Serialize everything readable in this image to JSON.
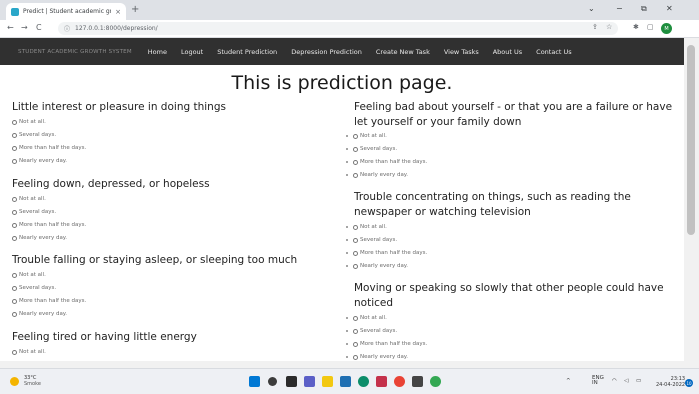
{
  "browser": {
    "tab_title": "Predict | Student academic grow",
    "tab_close": "×",
    "new_tab": "+",
    "url": "127.0.0.1:8000/depression/",
    "back": "←",
    "forward": "→",
    "reload": "C",
    "lock": "ⓘ",
    "minimize": "−",
    "restore": "⧉",
    "close": "✕",
    "chevron": "⌄",
    "share": "⇪",
    "star": "☆",
    "extensions": "✱",
    "sidepanel": "▢",
    "profile": "M"
  },
  "navbar": {
    "brand": "STUDENT ACADEMIC GROWTH SYSTEM",
    "links": [
      "Home",
      "Logout",
      "Student Prediction",
      "Depression Prediction",
      "Create New Task",
      "View Tasks",
      "About Us",
      "Contact Us"
    ]
  },
  "page": {
    "title": "This is prediction page."
  },
  "questions_left": [
    {
      "title": "Little interest or pleasure in doing things",
      "options": [
        "Not at all.",
        "Several days.",
        "More than half the days.",
        "Nearly every day."
      ]
    },
    {
      "title": "Feeling down, depressed, or hopeless",
      "options": [
        "Not at all.",
        "Several days.",
        "More than half the days.",
        "Nearly every day."
      ]
    },
    {
      "title": "Trouble falling or staying asleep, or sleeping too much",
      "options": [
        "Not at all.",
        "Several days.",
        "More than half the days.",
        "Nearly every day."
      ]
    },
    {
      "title": "Feeling tired or having little energy",
      "options": [
        "Not at all."
      ]
    }
  ],
  "questions_right": [
    {
      "title_line1": "Feeling bad about yourself - or that you are a failure or have",
      "title_line2": "let yourself or your family down",
      "options": [
        "Not at all.",
        "Several days.",
        "More than half the days.",
        "Nearly every day."
      ]
    },
    {
      "title_line1": "Trouble concentrating on things, such as reading the",
      "title_line2": "newspaper or watching television",
      "options": [
        "Not at all.",
        "Several days.",
        "More than half the days.",
        "Nearly every day."
      ]
    },
    {
      "title_line1": "Moving or speaking so slowly that other people could have",
      "title_line2": "noticed",
      "options": [
        "Not at all.",
        "Several days.",
        "More than half the days.",
        "Nearly every day."
      ]
    }
  ],
  "taskbar": {
    "weather_temp": "33°C",
    "weather_desc": "Smoke",
    "lang": "ENG",
    "region": "IN",
    "time": "23:13",
    "date": "24-04-2022",
    "notifications": "10",
    "tray_chevron": "^"
  },
  "colors": {
    "navbar_bg": "#303030",
    "tab_strip": "#dee1e6",
    "taskbar": "#eef0f4"
  }
}
